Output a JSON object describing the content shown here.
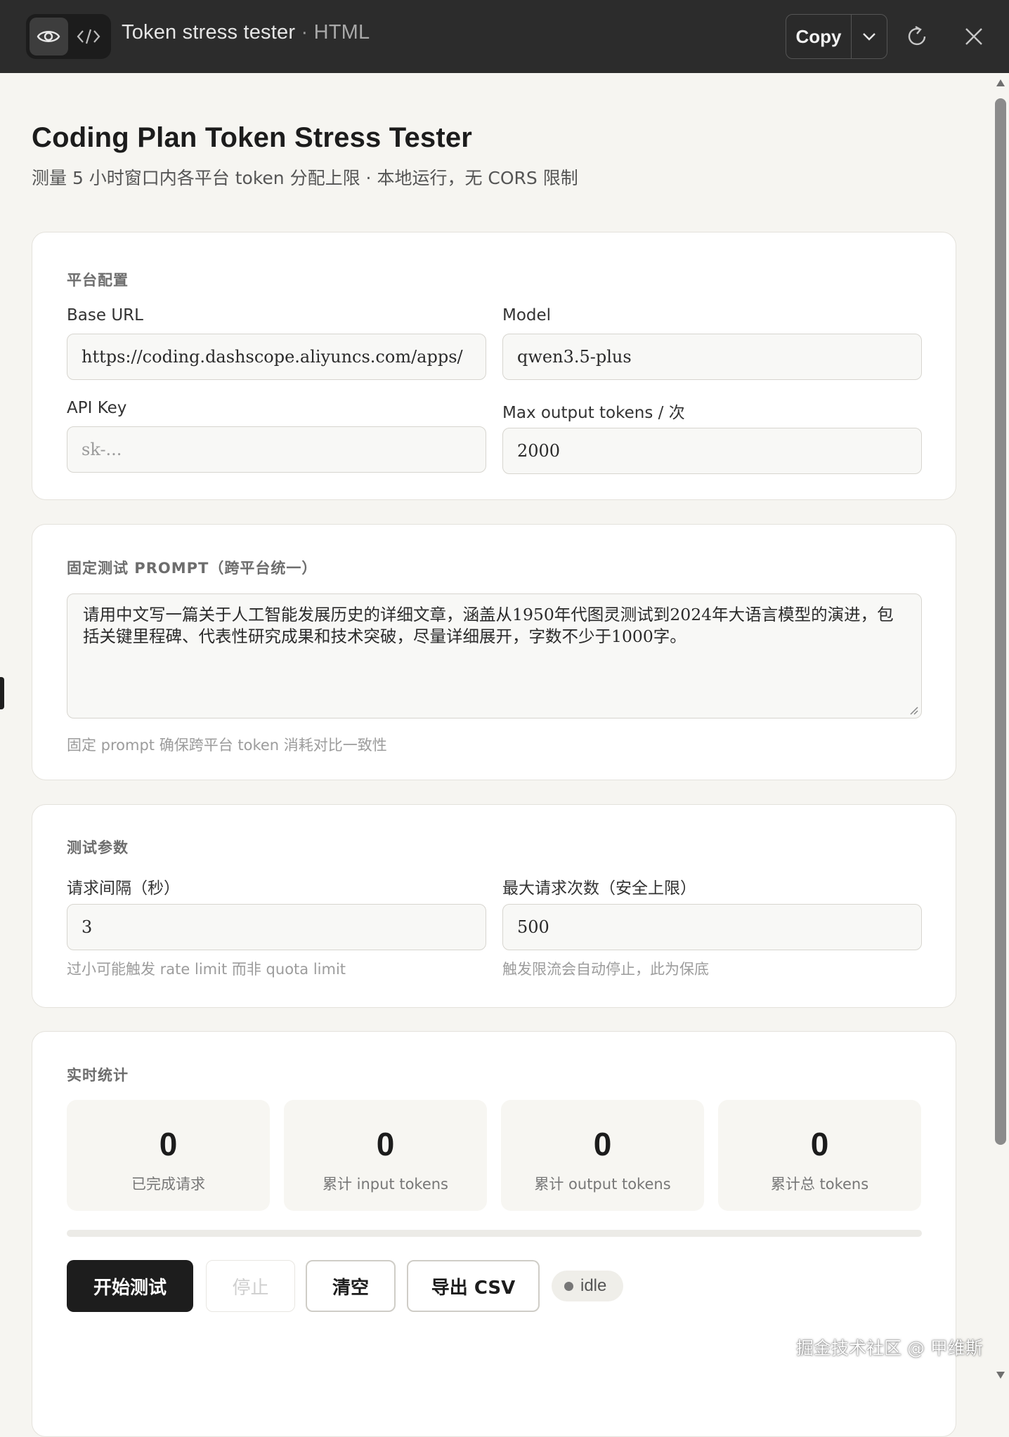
{
  "header": {
    "title": "Token stress tester",
    "separator": "·",
    "subtitle": "HTML",
    "copy_label": "Copy"
  },
  "page": {
    "title": "Coding Plan Token Stress Tester",
    "subtitle": "测量 5 小时窗口内各平台 token 分配上限 · 本地运行，无 CORS 限制"
  },
  "platform_config": {
    "section_title": "平台配置",
    "base_url_label": "Base URL",
    "base_url_value": "https://coding.dashscope.aliyuncs.com/apps/",
    "model_label": "Model",
    "model_value": "qwen3.5-plus",
    "api_key_label": "API Key",
    "api_key_placeholder": "sk-...",
    "max_tokens_label": "Max output tokens / 次",
    "max_tokens_value": "2000"
  },
  "prompt": {
    "section_title": "固定测试 PROMPT（跨平台统一）",
    "text": "请用中文写一篇关于人工智能发展历史的详细文章，涵盖从1950年代图灵测试到2024年大语言模型的演进，包括关键里程碑、代表性研究成果和技术突破，尽量详细展开，字数不少于1000字。",
    "hint": "固定 prompt 确保跨平台 token 消耗对比一致性"
  },
  "params": {
    "section_title": "测试参数",
    "interval_label": "请求间隔（秒）",
    "interval_value": "3",
    "interval_hint": "过小可能触发 rate limit 而非 quota limit",
    "max_requests_label": "最大请求次数（安全上限）",
    "max_requests_value": "500",
    "max_requests_hint": "触发限流会自动停止，此为保底"
  },
  "stats": {
    "section_title": "实时统计",
    "items": [
      {
        "value": "0",
        "label": "已完成请求"
      },
      {
        "value": "0",
        "label": "累计 input tokens"
      },
      {
        "value": "0",
        "label": "累计 output tokens"
      },
      {
        "value": "0",
        "label": "累计总 tokens"
      }
    ],
    "progress": 0
  },
  "actions": {
    "start_label": "开始测试",
    "stop_label": "停止",
    "clear_label": "清空",
    "export_label": "导出 CSV",
    "status": "idle"
  },
  "watermark": "掘金技术社区 @ 甲维斯",
  "colors": {
    "topbar": "#2c2c2c",
    "background": "#f6f5f1",
    "card": "#ffffff",
    "primary_button": "#1d1d1d"
  }
}
